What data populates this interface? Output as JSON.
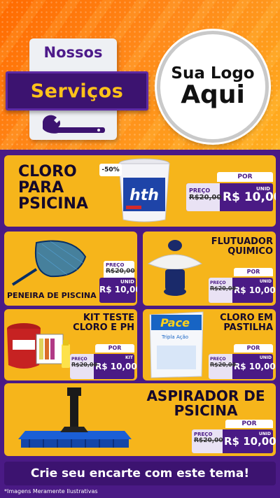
{
  "header": {
    "badge_top": "Nossos",
    "badge_main": "Serviços",
    "logo_line1": "Sua Logo",
    "logo_line2": "Aqui"
  },
  "products": [
    {
      "title": "CLORO PARA PSICINA",
      "discount": "-50%",
      "brand": "hth",
      "por": "POR",
      "preco": "PREÇO",
      "old_price": "R$20,00",
      "new_price": "R$ 10,00",
      "unit": "UNID"
    },
    {
      "title": "PENEIRA DE PISCINA",
      "por": "PREÇO",
      "old_price": "R$20,00",
      "new_price": "R$ 10,00",
      "unit": "UNID"
    },
    {
      "title": "FLUTUADOR QUIMICO",
      "por": "POR",
      "preco": "PREÇO",
      "old_price": "R$20,00",
      "new_price": "R$ 10,00",
      "unit": "UNID"
    },
    {
      "title": "KIT TESTE CLORO E PH",
      "por": "POR",
      "preco": "PREÇO",
      "old_price": "R$20,00",
      "new_price": "R$ 10,00",
      "unit": "KIT"
    },
    {
      "title": "CLORO EM PASTILHA",
      "brand": "Pace",
      "brand_sub": "Tripla Ação",
      "por": "POR",
      "preco": "PREÇO",
      "old_price": "R$20,00",
      "new_price": "R$ 10,00",
      "unit": "UNID"
    },
    {
      "title": "ASPIRADOR DE PSICINA",
      "por": "POR",
      "preco": "PREÇO",
      "old_price": "R$20,00",
      "new_price": "R$ 10,00",
      "unit": "UNID"
    }
  ],
  "footer": {
    "cta": "Crie seu encarte com este tema!",
    "disclaimer": "*Imagens Meramente Ilustrativas"
  },
  "colors": {
    "orange": "#ff7a00",
    "purple": "#4a1a85",
    "yellow": "#f6b51b",
    "gold_text": "#ffc21a"
  }
}
